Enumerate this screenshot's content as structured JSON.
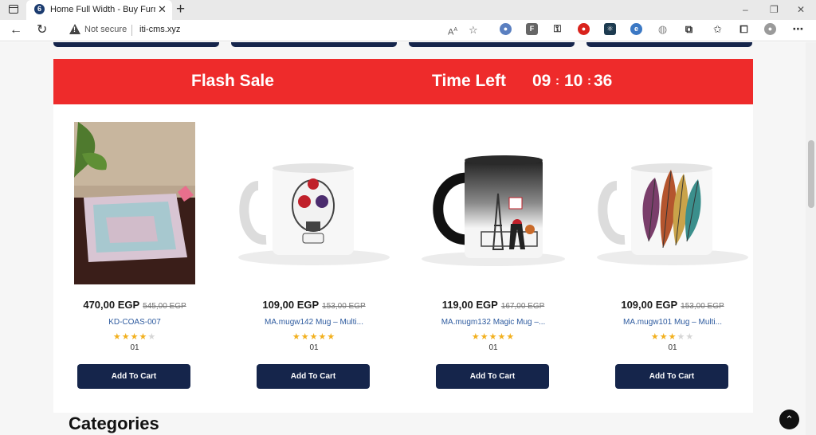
{
  "browser": {
    "tab_title": "Home Full Width - Buy Furniture",
    "tab_close": "✕",
    "new_tab": "+",
    "favicon_letter": "6",
    "security_label": "Not secure",
    "url": "iti-cms.xyz",
    "window_controls": [
      "–",
      "❐",
      "✕"
    ]
  },
  "page": {
    "flash_sale_title": "Flash Sale",
    "time_left_label": "Time Left",
    "countdown": {
      "hours": "09",
      "minutes": "10",
      "seconds": "36"
    },
    "products": [
      {
        "price": "470,00 EGP",
        "old_price": "545,00 EGP",
        "name": "KD-COAS-007",
        "rating": 4,
        "count": "01",
        "button": "Add To Cart",
        "image": "tray-photo"
      },
      {
        "price": "109,00 EGP",
        "old_price": "153,00 EGP",
        "name": "MA.mugw142 Mug – Multi...",
        "rating": 5,
        "count": "01",
        "button": "Add To Cart",
        "image": "sugar-skull-mug"
      },
      {
        "price": "119,00 EGP",
        "old_price": "167,00 EGP",
        "name": "MA.mugm132 Magic Mug –...",
        "rating": 5,
        "count": "01",
        "button": "Add To Cart",
        "image": "paris-magic-mug"
      },
      {
        "price": "109,00 EGP",
        "old_price": "153,00 EGP",
        "name": "MA.mugw101 Mug – Multi...",
        "rating": 3,
        "count": "01",
        "button": "Add To Cart",
        "image": "feathers-mug"
      }
    ],
    "categories_title": "Categories"
  },
  "colors": {
    "flash_red": "#ee2b2b",
    "navy": "#15254b",
    "star": "#f2b01e",
    "link_blue": "#2e5b9f"
  }
}
